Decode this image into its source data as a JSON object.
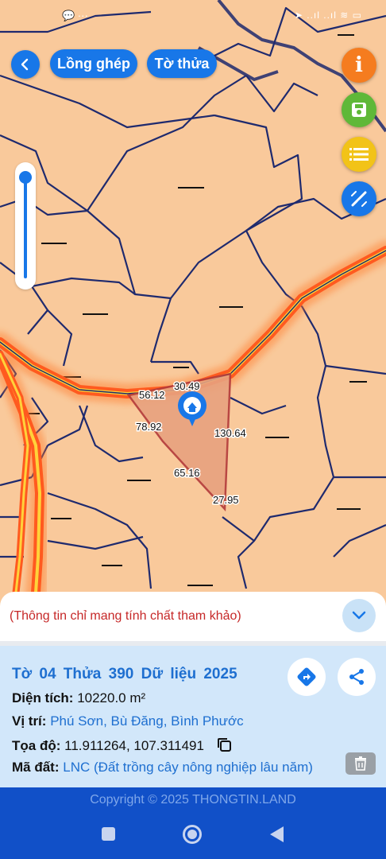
{
  "status_bar": {
    "left_text": "💬 ···",
    "right_text": "➤ ..ıl ..ıl ≋ ▭"
  },
  "toolbar": {
    "back_label": "Back",
    "overlay_label": "Lồng ghép",
    "sheet_label": "Tờ thửa"
  },
  "fabs": {
    "info_glyph": "i"
  },
  "parcel_labels": {
    "edge_top": "30.49",
    "edge_left_top": "56.12",
    "edge_left": "78.92",
    "edge_right": "130.64",
    "edge_bottom_left": "65.16",
    "edge_bottom": "27.95"
  },
  "notice": {
    "text": "(Thông tin chỉ mang tính chất tham khảo)"
  },
  "info": {
    "title": "Tờ 04   Thửa 390   Dữ liệu 2025",
    "area_label": "Diện tích:",
    "area_value": "10220.0 m²",
    "location_label": "Vị trí:",
    "location_value": "Phú Sơn, Bù Đăng, Bình Phước",
    "coords_label": "Tọa độ:",
    "coords_value": "11.911264, 107.311491",
    "land_code_label": "Mã đất:",
    "land_code_value": "LNC (Đất trồng cây nông nghiệp lâu năm)"
  },
  "footer": {
    "copyright": "Copyright © 2025 THONGTIN.LAND"
  },
  "colors": {
    "accent": "#1877e8",
    "map_land": "#f9c99b",
    "parcel_border": "#1f2a6e",
    "road": "#ff5a1f",
    "selected_parcel": "#e8a27f"
  }
}
